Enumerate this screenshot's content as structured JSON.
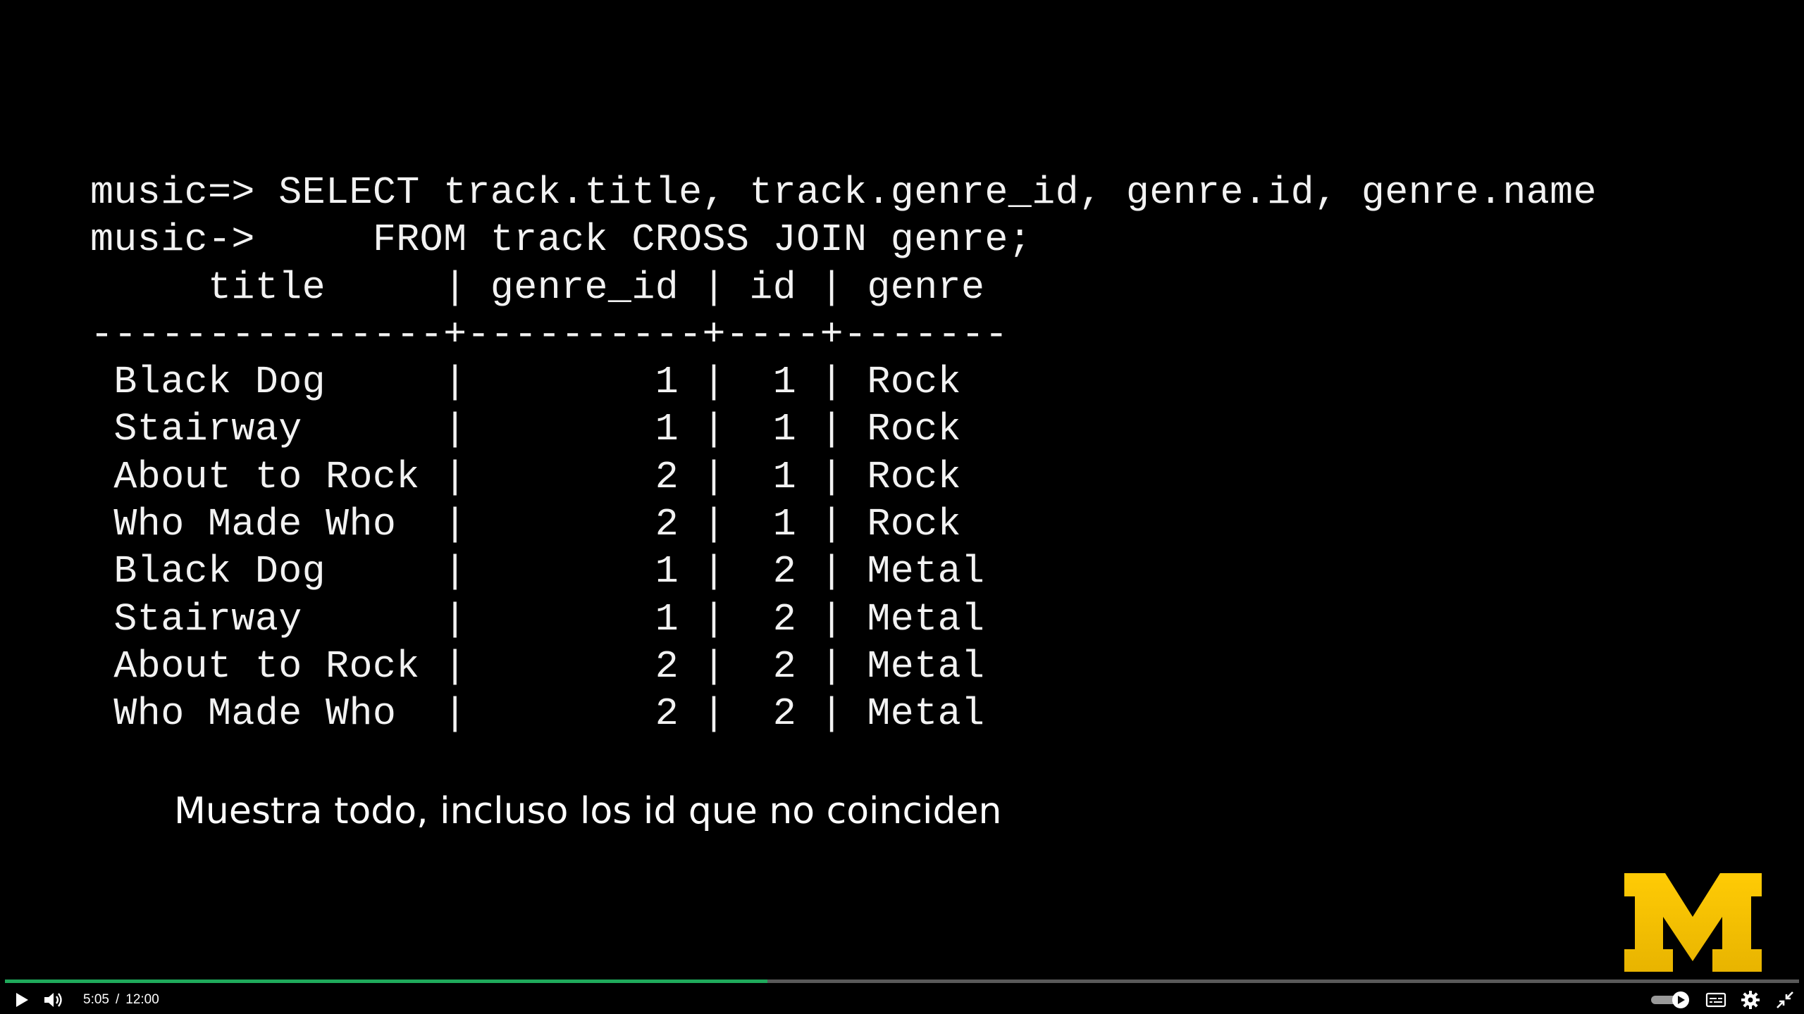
{
  "terminal": {
    "lines": [
      "music=> SELECT track.title, track.genre_id, genre.id, genre.name",
      "music->     FROM track CROSS JOIN genre;",
      "     title     | genre_id | id | genre",
      "---------------+----------+----+-------",
      " Black Dog     |        1 |  1 | Rock",
      " Stairway      |        1 |  1 | Rock",
      " About to Rock |        2 |  1 | Rock",
      " Who Made Who  |        2 |  1 | Rock",
      " Black Dog     |        1 |  2 | Metal",
      " Stairway      |        1 |  2 | Metal",
      " About to Rock |        2 |  2 | Metal",
      " Who Made Who  |        2 |  2 | Metal"
    ]
  },
  "subtitle": "Muestra todo, incluso los id que no coinciden",
  "logo": {
    "icon": "block-m-logo-icon",
    "color": "#ffcb05"
  },
  "player": {
    "current_time": "5:05",
    "separator": "/",
    "duration": "12:00",
    "progress_fraction": 0.425,
    "accent_color": "#1fa95b",
    "icons": {
      "play": "play-icon",
      "volume": "volume-icon",
      "autoplay": "autoplay-toggle-icon",
      "captions": "captions-icon",
      "settings": "gear-icon",
      "exit_fullscreen": "exit-fullscreen-icon"
    }
  }
}
